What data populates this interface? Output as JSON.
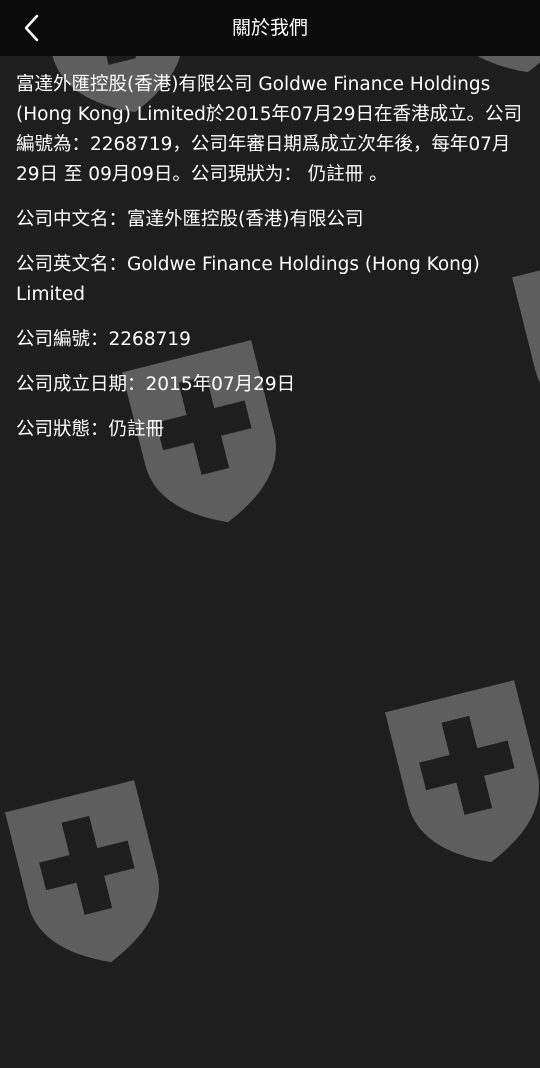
{
  "header": {
    "title": "關於我們",
    "back_icon": "chevron-left-icon"
  },
  "about": {
    "intro": "富達外匯控股(香港)有限公司 Goldwe Finance Holdings (Hong Kong) Limited於2015年07月29日在香港成立。公司編號為：2268719，公司年審日期爲成立次年後，每年07月29日 至 09月09日。公司現狀为： 仍註冊 。",
    "rows": [
      {
        "label": "公司中文名：",
        "value": "富達外匯控股(香港)有限公司"
      },
      {
        "label": "公司英文名：",
        "value": "Goldwe Finance Holdings (Hong Kong) Limited"
      },
      {
        "label": "公司編號：",
        "value": "2268719"
      },
      {
        "label": "公司成立日期：",
        "value": "2015年07月29日"
      },
      {
        "label": "公司狀態：",
        "value": "仍註冊"
      }
    ]
  },
  "watermark": {
    "icon": "shield-cross-icon",
    "color": "#5e5e5e",
    "cross_color": "#1e1e1e"
  },
  "colors": {
    "background": "#1e1e1e",
    "header_background": "#0b0b0b",
    "text": "#ffffff"
  }
}
